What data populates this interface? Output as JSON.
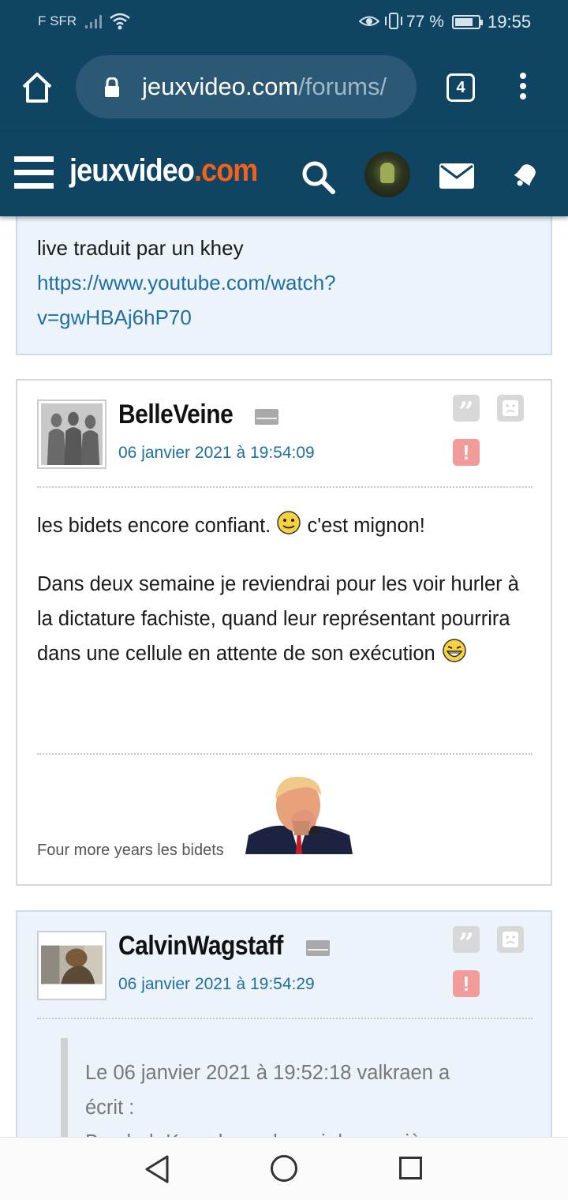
{
  "status_bar": {
    "carrier": "F SFR",
    "battery_text": "77 %",
    "battery_level": 0.77,
    "time": "19:55",
    "icons": [
      "signal-icon",
      "wifi-icon",
      "eye-comfort-icon",
      "vibrate-icon",
      "battery-icon"
    ]
  },
  "browser": {
    "url_domain": "jeuxvideo.com",
    "url_path": "/forums/",
    "tab_count": "4",
    "icons": [
      "home-icon",
      "lock-icon",
      "tabs-icon",
      "menu-icon"
    ]
  },
  "site_header": {
    "logo_main": "jeuxvideo",
    "logo_domain": ".com",
    "icons": [
      "hamburger-icon",
      "search-icon",
      "avatar",
      "mail-icon",
      "bell-icon"
    ]
  },
  "posts": [
    {
      "text_line1": "live traduit par un khey",
      "link_line1": "https://www.youtube.com/watch?",
      "link_line2": "v=gwHBAj6hP70"
    },
    {
      "author": "BelleVeine",
      "date": "06 janvier 2021 à 19:54:09",
      "paragraph1_a": "les bidets encore confiant.",
      "paragraph1_b": "c'est mignon!",
      "paragraph2": "Dans deux semaine je reviendrai pour les voir hurler à la dictature fachiste, quand leur représentant pourrira dans une cellule en attente de son exécution",
      "signature": "Four more years les bidets"
    },
    {
      "author": "CalvinWagstaff",
      "date": "06 janvier 2021 à 19:54:29",
      "quote_line1": "Le 06 janvier 2021 à 19:52:18 valkraen a",
      "quote_line2": "écrit :",
      "quote_line3": "Bon bah Kamala va devenir la première"
    }
  ],
  "post_actions": {
    "quote_glyph": "”",
    "alert_glyph": "!"
  },
  "nav": [
    "back-icon",
    "home-icon",
    "recent-apps-icon"
  ],
  "colors": {
    "header_bg": "#0f4462",
    "logo_accent": "#f5611b",
    "link": "#1f6fa3",
    "alt_post_bg": "#ecf3fa"
  }
}
